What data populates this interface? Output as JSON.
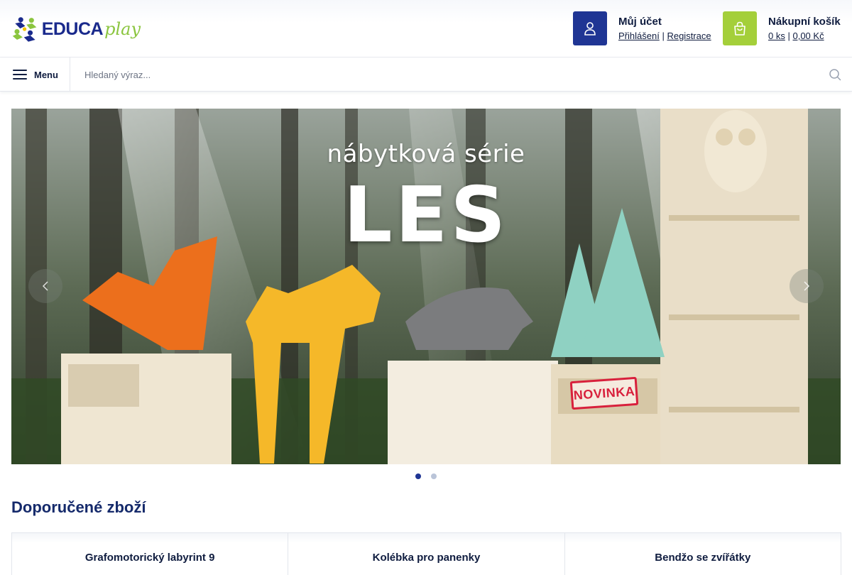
{
  "header": {
    "logo": {
      "text_main": "EDUCA",
      "text_sub": "play"
    },
    "account": {
      "title": "Můj účet",
      "login": "Přihlášení",
      "separator": "|",
      "register": "Registrace"
    },
    "cart": {
      "title": "Nákupní košík",
      "count": "0 ks",
      "separator": "|",
      "total": "0,00 Kč"
    }
  },
  "searchbar": {
    "menu_label": "Menu",
    "search_placeholder": "Hledaný výraz..."
  },
  "slider": {
    "headline": "nábytková série",
    "big_text": "LES",
    "badge": "NOVINKA",
    "slide_count": 2,
    "active_slide": 1
  },
  "recommended": {
    "title": "Doporučené zboží",
    "products": [
      {
        "name": "Grafomotorický labyrint 9"
      },
      {
        "name": "Kolébka pro panenky"
      },
      {
        "name": "Bendžo se zvířátky"
      }
    ]
  },
  "colors": {
    "brand_blue": "#1f3594",
    "brand_green": "#a4cf3a",
    "badge_red": "#d8203c"
  }
}
